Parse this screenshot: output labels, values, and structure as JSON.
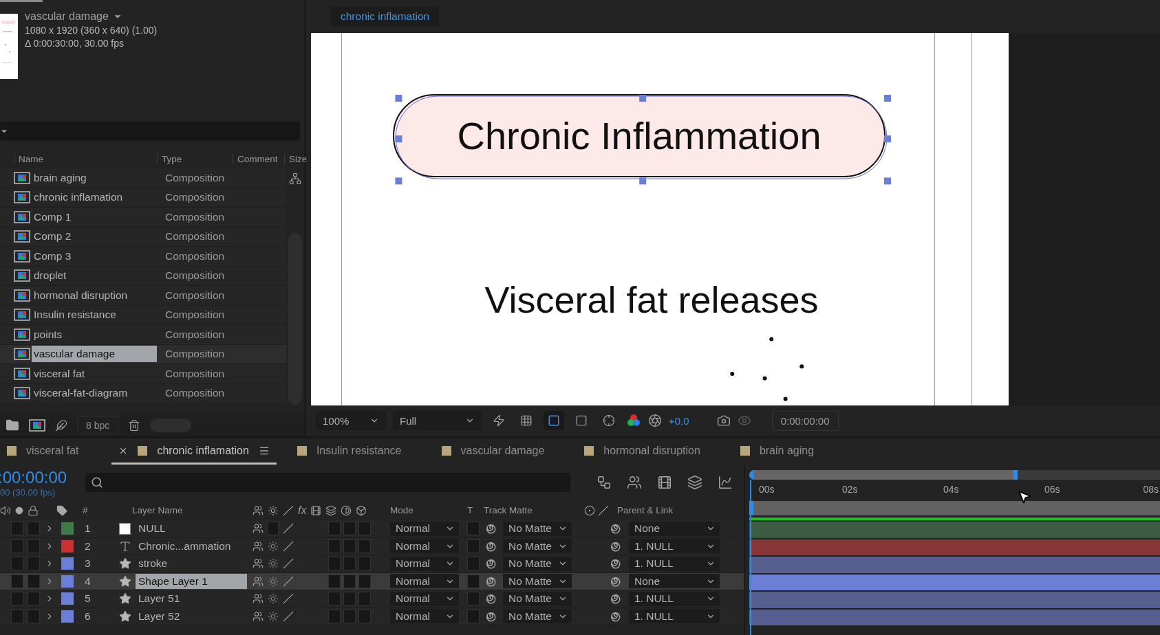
{
  "project": {
    "comp_name": "vascular damage",
    "comp_size": "1080 x 1920  (360 x 640) (1.00)",
    "comp_duration": "Δ 0:00:30:00, 30.00 fps",
    "columns": [
      "Name",
      "Type",
      "Comment",
      "Size"
    ],
    "items": [
      {
        "name": "brain aging",
        "type": "Composition",
        "selected": false
      },
      {
        "name": "chronic inflamation",
        "type": "Composition",
        "selected": false
      },
      {
        "name": "Comp 1",
        "type": "Composition",
        "selected": false
      },
      {
        "name": "Comp 2",
        "type": "Composition",
        "selected": false
      },
      {
        "name": "Comp 3",
        "type": "Composition",
        "selected": false
      },
      {
        "name": "droplet",
        "type": "Composition",
        "selected": false
      },
      {
        "name": "hormonal disruption",
        "type": "Composition",
        "selected": false
      },
      {
        "name": "Insulin resistance",
        "type": "Composition",
        "selected": false
      },
      {
        "name": "points",
        "type": "Composition",
        "selected": false
      },
      {
        "name": "vascular damage",
        "type": "Composition",
        "selected": true
      },
      {
        "name": "visceral fat",
        "type": "Composition",
        "selected": false
      },
      {
        "name": "visceral-fat-diagram",
        "type": "Composition",
        "selected": false
      }
    ],
    "bit_depth": "8 bpc"
  },
  "viewer": {
    "tab": "chronic inflamation",
    "title_text": "Chronic Inflammation",
    "body_text": "Visceral fat releases",
    "zoom": "100%",
    "resolution": "Full",
    "exposure": "+0.0",
    "timecode": "0:00:00:00"
  },
  "timeline": {
    "tabs": [
      {
        "label": "visceral fat",
        "selected": false
      },
      {
        "label": "chronic inflamation",
        "selected": true
      },
      {
        "label": "Insulin resistance",
        "selected": false
      },
      {
        "label": "vascular damage",
        "selected": false
      },
      {
        "label": "hormonal disruption",
        "selected": false
      },
      {
        "label": "brain aging",
        "selected": false
      }
    ],
    "timecode": ":00:00:00",
    "frame_info": "00 (30.00 fps)",
    "columns": {
      "number": "#",
      "layer_name": "Layer Name",
      "effects": "fx",
      "mode": "Mode",
      "preserve": "T",
      "track_matte": "Track Matte",
      "parent": "Parent & Link"
    },
    "ruler": [
      "00s",
      "02s",
      "04s",
      "06s",
      "08s"
    ],
    "layers": [
      {
        "number": "1",
        "name": "NULL",
        "kind": "null",
        "color": "#3f7a4a",
        "mode": "Normal",
        "track_matte": "No Matte",
        "parent": "None",
        "selected": false
      },
      {
        "number": "2",
        "name": "Chronic...ammation",
        "kind": "text",
        "color": "#c83232",
        "mode": "Normal",
        "track_matte": "No Matte",
        "parent": "1. NULL",
        "selected": false
      },
      {
        "number": "3",
        "name": "stroke",
        "kind": "shape",
        "color": "#6b7fd7",
        "mode": "Normal",
        "track_matte": "No Matte",
        "parent": "1. NULL",
        "selected": false
      },
      {
        "number": "4",
        "name": "Shape Layer 1",
        "kind": "shape",
        "color": "#6b7fd7",
        "mode": "Normal",
        "track_matte": "No Matte",
        "parent": "None",
        "selected": true
      },
      {
        "number": "5",
        "name": "Layer 51",
        "kind": "shape",
        "color": "#6b7fd7",
        "mode": "Normal",
        "track_matte": "No Matte",
        "parent": "1. NULL",
        "selected": false
      },
      {
        "number": "6",
        "name": "Layer 52",
        "kind": "shape",
        "color": "#6b7fd7",
        "mode": "Normal",
        "track_matte": "No Matte",
        "parent": "1. NULL",
        "selected": false
      }
    ]
  }
}
